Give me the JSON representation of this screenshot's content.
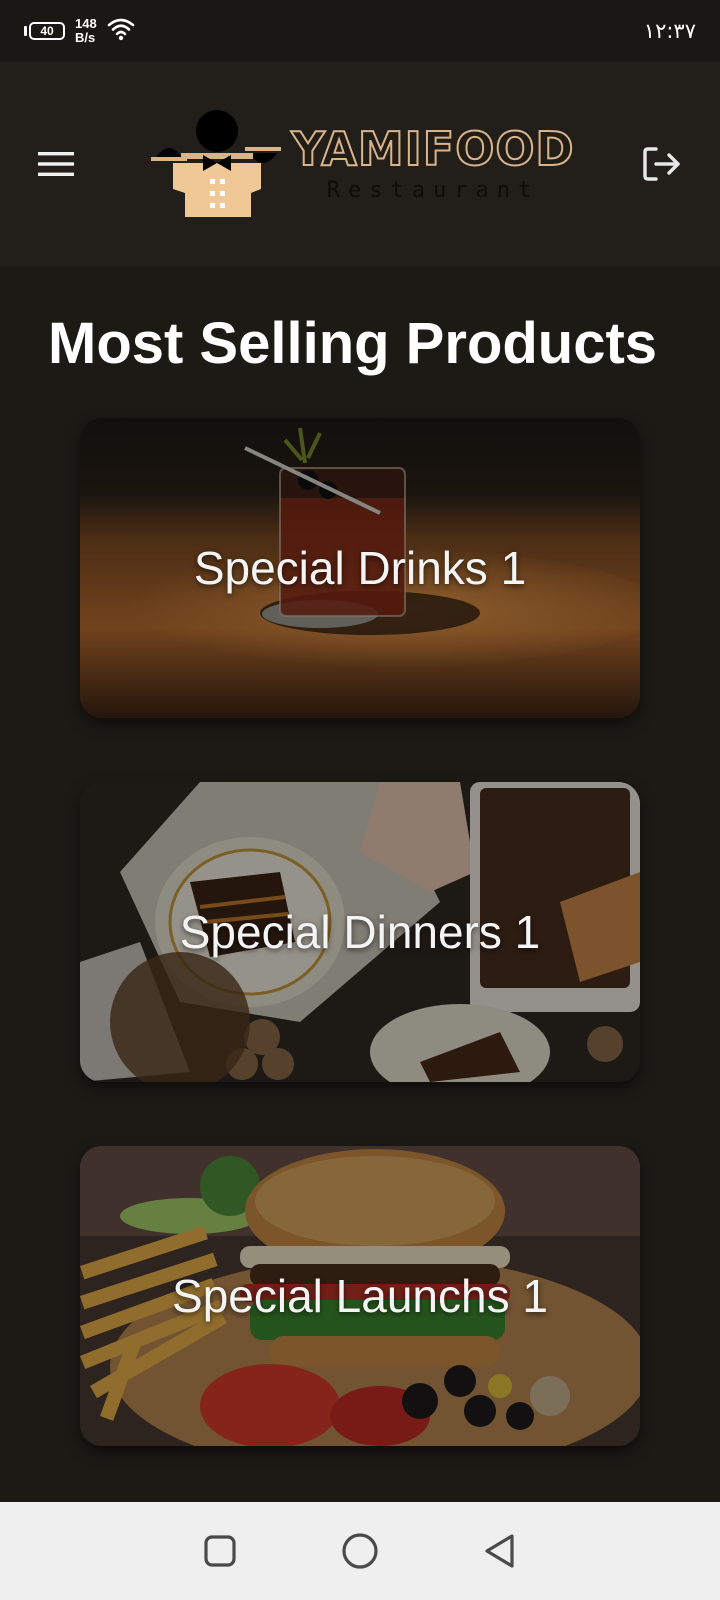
{
  "status_bar": {
    "battery": "40",
    "net_speed_value": "148",
    "net_speed_unit": "B/s",
    "clock": "۱۲:۳۷",
    "icons": [
      "battery-icon",
      "wifi-icon"
    ]
  },
  "header": {
    "logo_main": "YAMIFOOD",
    "logo_sub": "Restaurant",
    "icons": [
      "hamburger-menu-icon",
      "logout-icon"
    ]
  },
  "main": {
    "title": "Most Selling Products",
    "products": [
      {
        "label": "Special Drinks 1"
      },
      {
        "label": "Special Dinners 1"
      },
      {
        "label": "Special Launchs 1"
      }
    ]
  },
  "nav_bar": {
    "icons": [
      "recents-square-icon",
      "home-circle-icon",
      "back-triangle-icon"
    ]
  },
  "colors": {
    "background": "#1c1a15",
    "header_bg": "#221f1a",
    "logo_accent": "#d8b48a",
    "nav_bar_bg": "#efefef"
  }
}
